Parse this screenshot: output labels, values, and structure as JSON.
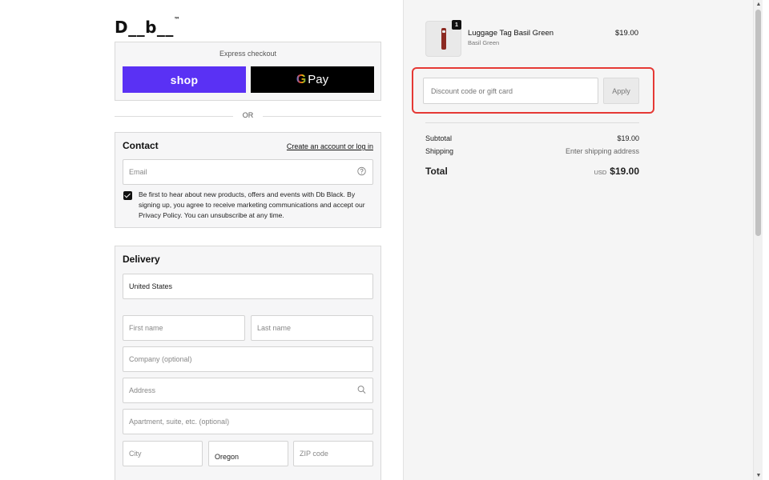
{
  "brand": {
    "logo": "D__b__",
    "mark": "™"
  },
  "express": {
    "title": "Express checkout",
    "shop_label": "shop",
    "gpay_g": "G",
    "gpay_label": "Pay"
  },
  "divider_or": "OR",
  "contact": {
    "heading": "Contact",
    "login_link": "Create an account or log in",
    "email_placeholder": "Email",
    "marketing_checked": true,
    "marketing_text": "Be first to hear about new products, offers and events with Db Black. By signing up, you agree to receive marketing communications and accept our Privacy Policy. You can unsubscribe at any time."
  },
  "delivery": {
    "heading": "Delivery",
    "country": "United States",
    "first_name_placeholder": "First name",
    "last_name_placeholder": "Last name",
    "company_placeholder": "Company (optional)",
    "address_placeholder": "Address",
    "apartment_placeholder": "Apartment, suite, etc. (optional)",
    "city_placeholder": "City",
    "state": "Oregon",
    "zip_placeholder": "ZIP code"
  },
  "cart": {
    "item": {
      "name": "Luggage Tag Basil Green",
      "variant": "Basil Green",
      "price": "$19.00",
      "quantity": "1"
    },
    "discount_placeholder": "Discount code or gift card",
    "apply_label": "Apply",
    "subtotal_label": "Subtotal",
    "subtotal_value": "$19.00",
    "shipping_label": "Shipping",
    "shipping_value": "Enter shipping address",
    "total_label": "Total",
    "total_currency": "USD",
    "total_value": "$19.00"
  },
  "colors": {
    "shop_brand": "#5a31f4",
    "highlight": "#e53935"
  }
}
